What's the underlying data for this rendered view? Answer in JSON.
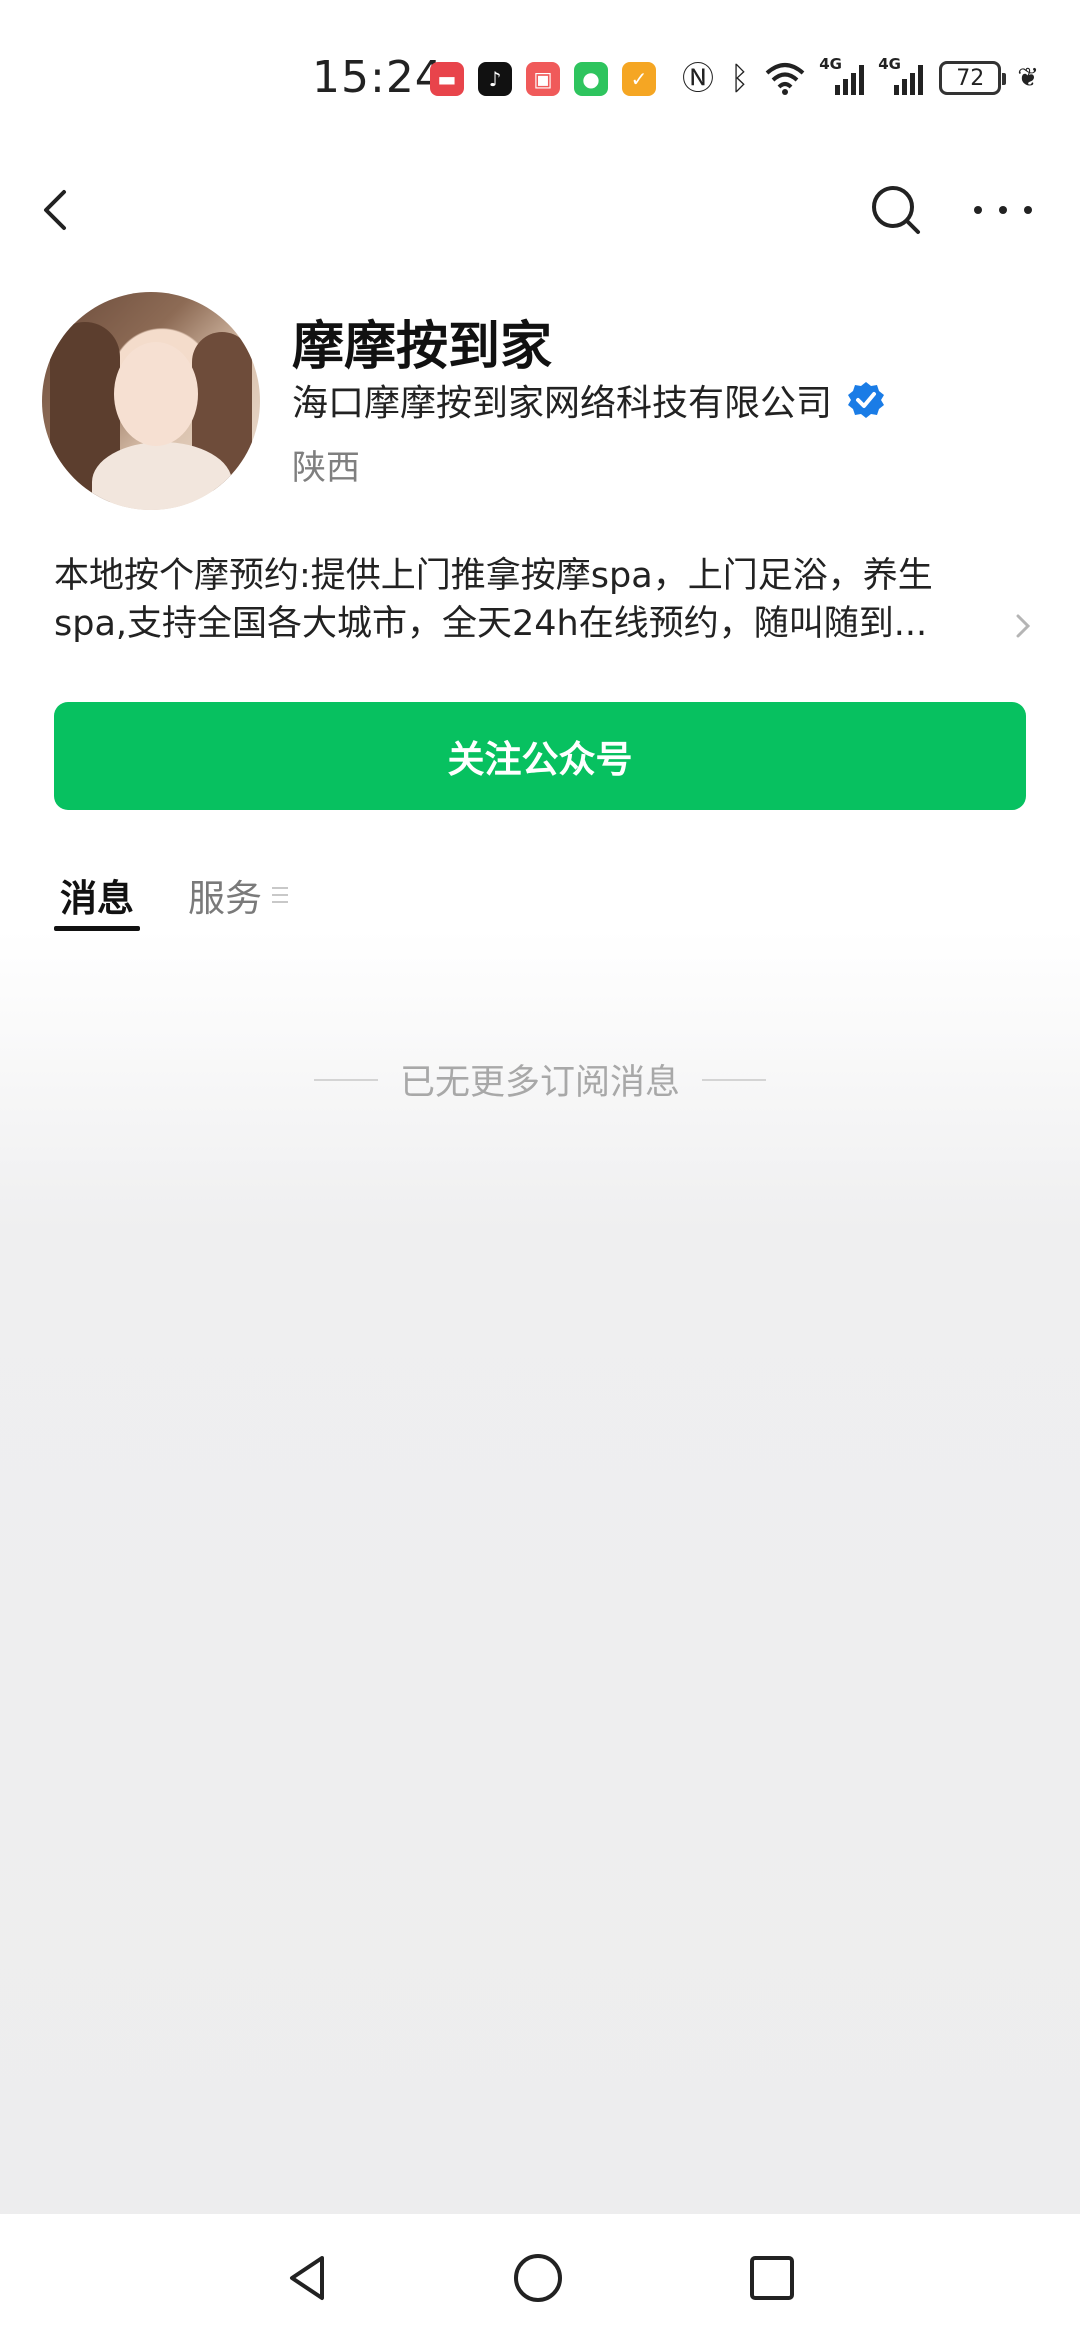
{
  "status_bar": {
    "time": "15:24",
    "battery": "72",
    "network_label": "4G",
    "app_icons": [
      "huawei-icon",
      "tiktok-icon",
      "red-app-icon",
      "wechat-icon",
      "orange-app-icon"
    ]
  },
  "nav": {
    "back_icon": "back-chevron-icon",
    "search_icon": "search-icon",
    "more_icon": "more-dots-icon"
  },
  "profile": {
    "name": "摩摩按到家",
    "company": "海口摩摩按到家网络科技有限公司",
    "location": "陕西",
    "description_line1": "本地按个摩预约:提供上门推拿按摩spa，上门足浴，养生",
    "description_line2": "spa,支持全国各大城市，全天24h在线预约，随叫随到..."
  },
  "follow_button": "关注公众号",
  "tabs": [
    {
      "label": "消息",
      "active": true
    },
    {
      "label": "服务",
      "active": false
    }
  ],
  "empty_message": "已无更多订阅消息",
  "colors": {
    "accent": "#07c160",
    "verified": "#1a7ce6"
  }
}
